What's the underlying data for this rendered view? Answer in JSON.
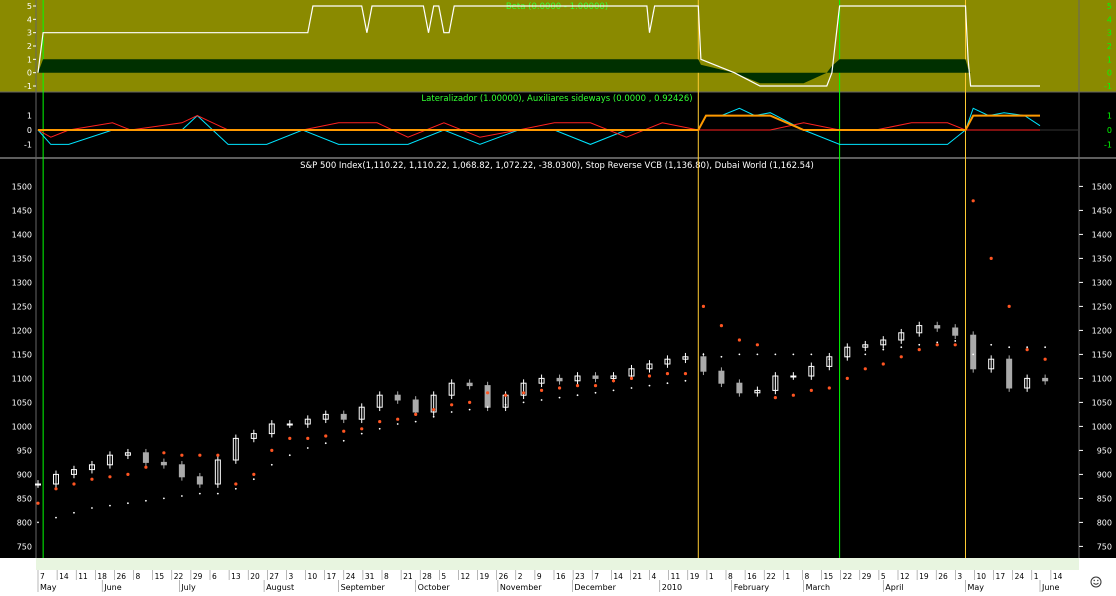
{
  "colors": {
    "olive_bg": "#8a8a00",
    "black_bg": "#000000",
    "axis_text": "#ffffff",
    "bull_line": "#ffffff",
    "bear_fill": "#003000",
    "osc_red": "#ff2020",
    "osc_cyan": "#00e5ff",
    "osc_orange": "#ff9900",
    "marker_green": "#00ff00",
    "marker_yellow": "#ffcc33",
    "stop_dot": "#ff5522",
    "dubai_dot": "#ffffff",
    "candle_up": "#ffffff",
    "candle_down": "#aaaaaa",
    "title_green": "#33ff33"
  },
  "panels": {
    "top": {
      "title": "Beta (0.0000 - 1.00000)",
      "y_ticks": [
        "5",
        "4",
        "3",
        "2",
        "1",
        "0",
        "-1"
      ]
    },
    "middle": {
      "title": "Lateralizador (1.00000), Auxiliares sideways (0.0000 , 0.92426)",
      "y_ticks": [
        "1",
        "0",
        "-1"
      ]
    },
    "main": {
      "title": "S&P 500 Index(1,110.22, 1,110.22, 1,068.82, 1,072.22, -38.0300), Stop Reverse VCB (1,136.80), Dubai World (1,162.54)",
      "y_ticks": [
        "1500",
        "1450",
        "1400",
        "1350",
        "1300",
        "1250",
        "1200",
        "1150",
        "1100",
        "1050",
        "1000",
        "950",
        "900",
        "850",
        "800",
        "750"
      ]
    }
  },
  "x_axis": {
    "day_labels": [
      "7",
      "14",
      "11",
      "18",
      "26",
      "8",
      "15",
      "22",
      "29",
      "6",
      "13",
      "20",
      "27",
      "3",
      "10",
      "17",
      "24",
      "31",
      "8",
      "21",
      "28",
      "5",
      "12",
      "19",
      "26",
      "2",
      "9",
      "16",
      "23",
      "7",
      "14",
      "21",
      "4",
      "11",
      "19",
      "1",
      "8",
      "16",
      "22",
      "1",
      "8",
      "15",
      "22",
      "29",
      "5",
      "12",
      "19",
      "26",
      "3",
      "10",
      "17",
      "24",
      "1",
      "14"
    ],
    "month_labels": [
      "May",
      "June",
      "July",
      "August",
      "September",
      "October",
      "November",
      "December",
      "2010",
      "February",
      "March",
      "April",
      "May",
      "June"
    ]
  },
  "corner_icon": "smiley-icon",
  "chart_data": [
    {
      "type": "line",
      "title": "Beta (0.0000 - 1.00000)",
      "ylim": [
        -1.3,
        5.3
      ],
      "x": [
        "2009-05-07",
        "2009-05-09",
        "2009-06-12",
        "2009-06-15",
        "2009-08-20",
        "2009-08-22",
        "2009-08-25",
        "2009-09-10",
        "2009-09-12",
        "2009-09-14",
        "2009-10-04",
        "2009-10-06",
        "2009-10-08",
        "2009-10-10",
        "2009-10-12",
        "2009-10-14",
        "2009-10-16",
        "2009-12-30",
        "2009-12-31",
        "2010-01-02",
        "2010-01-19",
        "2010-01-20",
        "2010-02-02",
        "2010-02-12",
        "2010-03-01",
        "2010-03-10",
        "2010-03-12",
        "2010-03-15",
        "2010-05-03",
        "2010-05-04",
        "2010-05-05",
        "2010-06-01"
      ],
      "series": [
        {
          "values": [
            0,
            3,
            3,
            3,
            3,
            5,
            5,
            5,
            3,
            5,
            5,
            3,
            5,
            5,
            3,
            3,
            5,
            5,
            3,
            5,
            5,
            1,
            0,
            -1,
            -1,
            -1,
            0,
            5,
            5,
            1,
            -1,
            -1
          ]
        },
        {
          "values": [
            0,
            1,
            1,
            1,
            1,
            1,
            1,
            1,
            1,
            1,
            1,
            1,
            1,
            1,
            1,
            1,
            1,
            1,
            1,
            1,
            1,
            0.6,
            0,
            -0.8,
            -0.8,
            0,
            0.5,
            1,
            1,
            0.3,
            0,
            0
          ]
        }
      ]
    },
    {
      "type": "line",
      "title": "Lateralizador (1.00000), Auxiliares sideways (0.0000 , 0.92426)",
      "ylim": [
        -1.8,
        1.8
      ],
      "x": [
        "2009-05-07",
        "2009-05-12",
        "2009-05-19",
        "2009-06-05",
        "2009-06-12",
        "2009-07-02",
        "2009-07-08",
        "2009-07-14",
        "2009-07-20",
        "2009-08-04",
        "2009-08-18",
        "2009-09-01",
        "2009-09-16",
        "2009-09-28",
        "2009-10-12",
        "2009-10-26",
        "2009-11-10",
        "2009-11-24",
        "2009-12-08",
        "2009-12-22",
        "2010-01-05",
        "2010-01-19",
        "2010-01-22",
        "2010-01-28",
        "2010-02-04",
        "2010-02-10",
        "2010-02-16",
        "2010-03-01",
        "2010-03-15",
        "2010-03-29",
        "2010-04-12",
        "2010-04-26",
        "2010-05-03",
        "2010-05-06",
        "2010-05-12",
        "2010-05-18",
        "2010-05-26",
        "2010-06-01"
      ],
      "series": [
        {
          "values": [
            0,
            -1,
            -1,
            0,
            0,
            0,
            1,
            0,
            -1,
            -1,
            0,
            -1,
            -1,
            -1,
            0,
            -1,
            0,
            0,
            -1,
            0,
            0,
            0,
            1,
            1,
            1.5,
            1,
            1.2,
            0,
            -1,
            -1,
            -1,
            -1,
            0,
            1.5,
            1,
            1.2,
            1,
            0.3
          ]
        },
        {
          "values": [
            0,
            -0.5,
            0,
            0.5,
            0,
            0.5,
            1,
            0.5,
            0,
            0,
            0,
            0.5,
            0.5,
            -0.5,
            0.5,
            -0.5,
            0,
            0.5,
            0.5,
            -0.5,
            0.5,
            0,
            0,
            0,
            0,
            0,
            0,
            0.5,
            0,
            0,
            0.5,
            0.5,
            0,
            0,
            0,
            0,
            0,
            0
          ]
        },
        {
          "values": [
            0,
            0,
            0,
            0,
            0,
            0,
            0,
            0,
            0,
            0,
            0,
            0,
            0,
            0,
            0,
            0,
            0,
            0,
            0,
            0,
            0,
            0,
            1,
            1,
            1,
            1,
            1,
            0,
            0,
            0,
            0,
            0,
            0,
            1,
            1,
            1,
            1,
            1
          ]
        }
      ]
    },
    {
      "type": "line",
      "title": "S&P 500 Index(1,110.22, 1,110.22, 1,068.82, 1,072.22, -38.0300), Stop Reverse VCB (1,136.80), Dubai World (1,162.54)",
      "ylim": [
        730,
        1530
      ],
      "x": [
        "2009-05-07",
        "2009-05-14",
        "2009-05-21",
        "2009-05-28",
        "2009-06-04",
        "2009-06-11",
        "2009-06-18",
        "2009-06-25",
        "2009-07-02",
        "2009-07-09",
        "2009-07-16",
        "2009-07-23",
        "2009-07-30",
        "2009-08-06",
        "2009-08-13",
        "2009-08-20",
        "2009-08-27",
        "2009-09-03",
        "2009-09-10",
        "2009-09-17",
        "2009-09-24",
        "2009-10-01",
        "2009-10-08",
        "2009-10-15",
        "2009-10-22",
        "2009-10-29",
        "2009-11-05",
        "2009-11-12",
        "2009-11-19",
        "2009-11-26",
        "2009-12-03",
        "2009-12-10",
        "2009-12-17",
        "2009-12-24",
        "2009-12-31",
        "2010-01-07",
        "2010-01-14",
        "2010-01-21",
        "2010-01-28",
        "2010-02-04",
        "2010-02-11",
        "2010-02-18",
        "2010-02-25",
        "2010-03-04",
        "2010-03-11",
        "2010-03-18",
        "2010-03-25",
        "2010-04-01",
        "2010-04-08",
        "2010-04-15",
        "2010-04-22",
        "2010-04-29",
        "2010-05-06",
        "2010-05-13",
        "2010-05-20",
        "2010-05-27",
        "2010-06-03"
      ],
      "series": [
        {
          "name": "S&P 500 Index",
          "values": [
            880,
            900,
            910,
            920,
            940,
            945,
            925,
            920,
            895,
            880,
            930,
            975,
            985,
            1005,
            1005,
            1015,
            1025,
            1015,
            1040,
            1065,
            1055,
            1030,
            1065,
            1090,
            1085,
            1040,
            1065,
            1090,
            1100,
            1095,
            1105,
            1100,
            1105,
            1120,
            1130,
            1140,
            1145,
            1115,
            1090,
            1070,
            1075,
            1105,
            1105,
            1125,
            1145,
            1165,
            1170,
            1180,
            1195,
            1210,
            1205,
            1190,
            1120,
            1140,
            1080,
            1100,
            1095
          ]
        },
        {
          "name": "Stop Reverse VCB",
          "values": [
            840,
            870,
            880,
            890,
            895,
            900,
            915,
            945,
            940,
            940,
            940,
            880,
            900,
            950,
            975,
            975,
            980,
            990,
            995,
            1010,
            1015,
            1025,
            1035,
            1045,
            1050,
            1070,
            1065,
            1070,
            1075,
            1080,
            1085,
            1085,
            1095,
            1100,
            1105,
            1110,
            1110,
            1250,
            1210,
            1180,
            1170,
            1060,
            1065,
            1075,
            1080,
            1100,
            1120,
            1130,
            1145,
            1160,
            1170,
            1170,
            1470,
            1350,
            1250,
            1160,
            1140
          ]
        },
        {
          "name": "Dubai World",
          "values": [
            800,
            810,
            820,
            830,
            835,
            840,
            845,
            850,
            855,
            860,
            860,
            870,
            890,
            920,
            940,
            955,
            965,
            970,
            985,
            995,
            1005,
            1010,
            1020,
            1030,
            1035,
            1040,
            1045,
            1050,
            1055,
            1060,
            1065,
            1070,
            1075,
            1080,
            1085,
            1090,
            1095,
            1150,
            1145,
            1150,
            1150,
            1150,
            1150,
            1150,
            1140,
            1145,
            1150,
            1160,
            1165,
            1170,
            1175,
            1178,
            1150,
            1170,
            1165,
            1165,
            1165
          ]
        }
      ]
    }
  ]
}
